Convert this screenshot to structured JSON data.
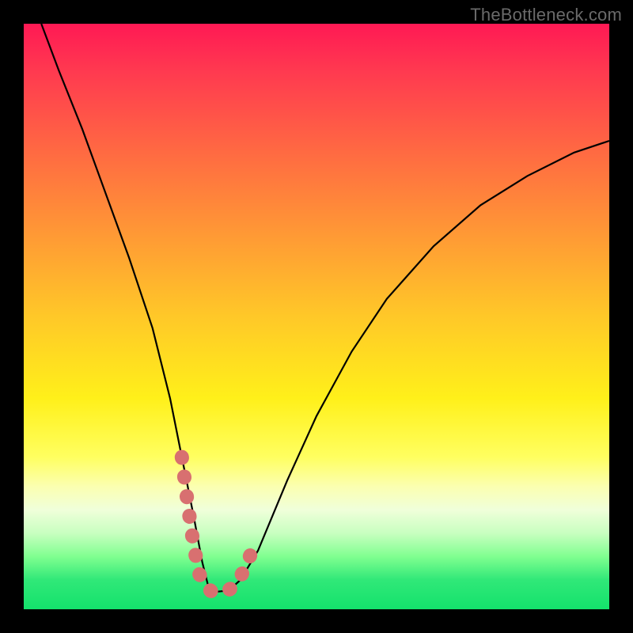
{
  "watermark": "TheBottleneck.com",
  "chart_data": {
    "type": "line",
    "title": "",
    "xlabel": "",
    "ylabel": "",
    "xlim": [
      0,
      100
    ],
    "ylim": [
      0,
      100
    ],
    "series": [
      {
        "name": "bottleneck-curve",
        "x": [
          3,
          6,
          10,
          14,
          18,
          22,
          25,
          27,
          29,
          30.5,
          31.5,
          33,
          35,
          37,
          40,
          45,
          50,
          56,
          62,
          70,
          78,
          86,
          94,
          100
        ],
        "y": [
          100,
          92,
          82,
          71,
          60,
          48,
          36,
          26,
          16,
          8,
          4,
          3,
          3.2,
          5,
          10,
          22,
          33,
          44,
          53,
          62,
          69,
          74,
          78,
          80
        ]
      }
    ],
    "highlight": {
      "name": "optimal-range",
      "color": "#d87070",
      "x": [
        27,
        28,
        29,
        30,
        31,
        32,
        33,
        34,
        35,
        36,
        37,
        38,
        39
      ],
      "y": [
        26,
        18,
        11,
        6,
        4,
        3.1,
        3,
        3.1,
        3.3,
        4,
        5.5,
        7.5,
        10
      ]
    }
  }
}
